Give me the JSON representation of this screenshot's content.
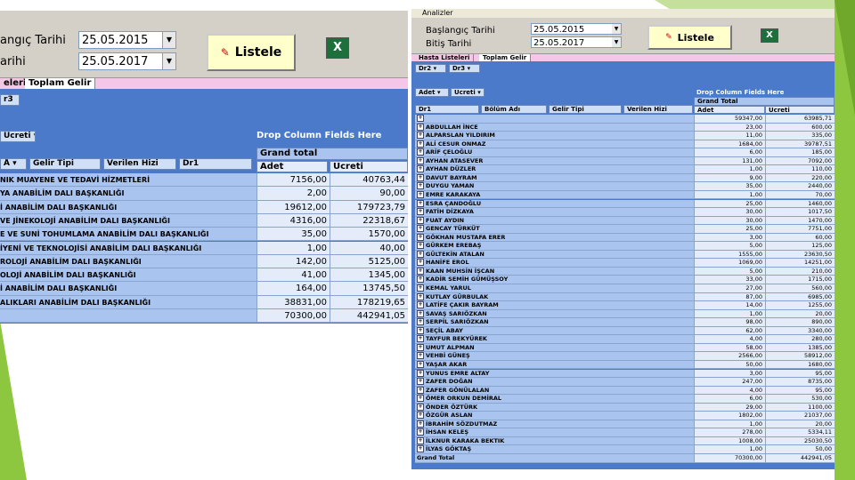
{
  "colors": {
    "green": "#8dc63f",
    "pink": "#f5c6e8",
    "pivot_blue": "#4a7ac9",
    "row_blue": "#a9c5ef",
    "cell_light": "#e4ecf9"
  },
  "left": {
    "start_label": "angıç Tarihi",
    "start_date": "25.05.2015",
    "end_label": "arihi",
    "end_date": "25.05.2017",
    "button": "Listele",
    "excel_icon": "excel-icon",
    "tabs": [
      "eleri",
      "Toplam Gelir"
    ],
    "filter": "r3",
    "fields": [
      "Ücreti",
      "Gelir Tipi",
      "Verilen Hizi",
      "Dr1"
    ],
    "drop_col": "Drop Column Fields Here",
    "grand_total": "Grand total",
    "adet": "Adet",
    "ucreti": "Ücreti",
    "rows": [
      {
        "name": "NIK MUAYENE VE TEDAVİ HİZMETLERİ",
        "adet": "7156,00",
        "ucret": "40763,44"
      },
      {
        "name": "YA ANABİLİM DALI BAŞKANLIĞI",
        "adet": "2,00",
        "ucret": "90,00"
      },
      {
        "name": "İ ANABİLİM DALI BAŞKANLIĞI",
        "adet": "19612,00",
        "ucret": "179723,79"
      },
      {
        "name": "VE JİNEKOLOJİ ANABİLİM DALI BAŞKANLIĞI",
        "adet": "4316,00",
        "ucret": "22318,67"
      },
      {
        "name": "E VE SUNİ TOHUMLAMA ANABİLİM DALI BAŞKANLIĞI",
        "adet": "35,00",
        "ucret": "1570,00"
      },
      {
        "name": "İYENİ VE TEKNOLOJİSİ ANABİLİM DALI BAŞKANLIĞI",
        "adet": "1,00",
        "ucret": "40,00"
      },
      {
        "name": "ROLOJİ ANABİLİM DALI BAŞKANLIĞI",
        "adet": "142,00",
        "ucret": "5125,00"
      },
      {
        "name": "OLOJİ ANABİLİM DALI BAŞKANLIĞI",
        "adet": "41,00",
        "ucret": "1345,00"
      },
      {
        "name": "İ ANABİLİM DALI BAŞKANLIĞI",
        "adet": "164,00",
        "ucret": "13745,50"
      },
      {
        "name": "ALIKLARI ANABİLİM DALI BAŞKANLIĞI",
        "adet": "38831,00",
        "ucret": "178219,65"
      }
    ],
    "total": {
      "adet": "70300,00",
      "ucret": "442941,05"
    }
  },
  "right": {
    "title": "Analizler",
    "start_label": "Başlangıç Tarihi",
    "start_date": "25.05.2015",
    "end_label": "Bitiş Tarihi",
    "end_date": "25.05.2017",
    "button": "Listele",
    "tabs": [
      "Hasta Listeleri",
      "Toplam Gelir"
    ],
    "filters": [
      "Dr2",
      "Dr3"
    ],
    "fields": [
      "Adet",
      "Ücreti"
    ],
    "row_fields": [
      "Dr1",
      "Bölüm Adı",
      "Gelir Tipi",
      "Verilen Hizi"
    ],
    "drop_col": "Drop Column Fields Here",
    "grand_total": "Grand Total",
    "adet": "Adet",
    "ucreti": "Ücreti",
    "rows": [
      {
        "name": "",
        "adet": "59347,00",
        "ucret": "63985,71"
      },
      {
        "name": "ABDULLAH İNCE",
        "adet": "23,00",
        "ucret": "600,00"
      },
      {
        "name": "ALPARSLAN YILDIRIM",
        "adet": "11,00",
        "ucret": "335,00"
      },
      {
        "name": "ALİ CESUR ONMAZ",
        "adet": "1684,00",
        "ucret": "39787,51"
      },
      {
        "name": "ARİF ÇELOĞLU",
        "adet": "6,00",
        "ucret": "185,00"
      },
      {
        "name": "AYHAN ATASEVER",
        "adet": "131,00",
        "ucret": "7092,00"
      },
      {
        "name": "AYHAN DÜZLER",
        "adet": "1,00",
        "ucret": "110,00"
      },
      {
        "name": "DAVUT BAYRAM",
        "adet": "9,00",
        "ucret": "220,00"
      },
      {
        "name": "DUYGU YAMAN",
        "adet": "35,00",
        "ucret": "2440,00"
      },
      {
        "name": "EMRE KARAKAYA",
        "adet": "1,00",
        "ucret": "70,00"
      },
      {
        "name": "ESRA ÇANDOĞLU",
        "adet": "25,00",
        "ucret": "1460,00"
      },
      {
        "name": "FATİH DİZKAYA",
        "adet": "30,00",
        "ucret": "1017,50"
      },
      {
        "name": "FUAT AYDIN",
        "adet": "30,00",
        "ucret": "1470,00"
      },
      {
        "name": "GENCAY TÜRKÜT",
        "adet": "25,00",
        "ucret": "7751,00"
      },
      {
        "name": "GÖKHAN MUSTAFA ERER",
        "adet": "3,00",
        "ucret": "60,00"
      },
      {
        "name": "GÜRKEM EREBAŞ",
        "adet": "5,00",
        "ucret": "125,00"
      },
      {
        "name": "GÜLTEKİN ATALAN",
        "adet": "1555,00",
        "ucret": "23630,50"
      },
      {
        "name": "HANİFE EROL",
        "adet": "1069,00",
        "ucret": "14251,00"
      },
      {
        "name": "KAAN MUHSİN İŞCAN",
        "adet": "5,00",
        "ucret": "210,00"
      },
      {
        "name": "KADİR SEMİH GÜMÜŞSOY",
        "adet": "33,00",
        "ucret": "1715,00"
      },
      {
        "name": "KEMAL YARUL",
        "adet": "27,00",
        "ucret": "560,00"
      },
      {
        "name": "KUTLAY GÜRBULAK",
        "adet": "87,00",
        "ucret": "6985,00"
      },
      {
        "name": "LATİFE ÇAKIR BAYRAM",
        "adet": "14,00",
        "ucret": "1255,00"
      },
      {
        "name": "SAVAŞ SARIÖZKAN",
        "adet": "1,00",
        "ucret": "20,00"
      },
      {
        "name": "SERPİL SARIÖZKAN",
        "adet": "98,00",
        "ucret": "890,00"
      },
      {
        "name": "SEÇİL ABAY",
        "adet": "62,00",
        "ucret": "3340,00"
      },
      {
        "name": "TAYFUR BEKYÜREK",
        "adet": "4,00",
        "ucret": "280,00"
      },
      {
        "name": "UMUT ALPMAN",
        "adet": "58,00",
        "ucret": "1385,00"
      },
      {
        "name": "VEHBİ GÜNEŞ",
        "adet": "2566,00",
        "ucret": "58912,00"
      },
      {
        "name": "YAŞAR AKAR",
        "adet": "50,00",
        "ucret": "1680,00"
      },
      {
        "name": "YUNUS EMRE ALTAY",
        "adet": "3,00",
        "ucret": "95,00"
      },
      {
        "name": "ZAFER DOĞAN",
        "adet": "247,00",
        "ucret": "8735,00"
      },
      {
        "name": "ZAFER GÖNÜLALAN",
        "adet": "4,00",
        "ucret": "95,00"
      },
      {
        "name": "ÖMER ORKUN DEMİRAL",
        "adet": "6,00",
        "ucret": "530,00"
      },
      {
        "name": "ÖNDER ÖZTÜRK",
        "adet": "29,00",
        "ucret": "1100,00"
      },
      {
        "name": "ÖZGÜR ASLAN",
        "adet": "1802,00",
        "ucret": "21037,00"
      },
      {
        "name": "İBRAHİM SÖZDUTMAZ",
        "adet": "1,00",
        "ucret": "20,00"
      },
      {
        "name": "İHSAN KELEŞ",
        "adet": "278,00",
        "ucret": "5334,11"
      },
      {
        "name": "İLKNUR KARAKA BEKTIK",
        "adet": "1008,00",
        "ucret": "25030,50"
      },
      {
        "name": "İLYAS GÖKTAŞ",
        "adet": "1,00",
        "ucret": "50,00"
      }
    ],
    "total": {
      "label": "Grand Total",
      "adet": "70300,00",
      "ucret": "442941,05"
    }
  }
}
